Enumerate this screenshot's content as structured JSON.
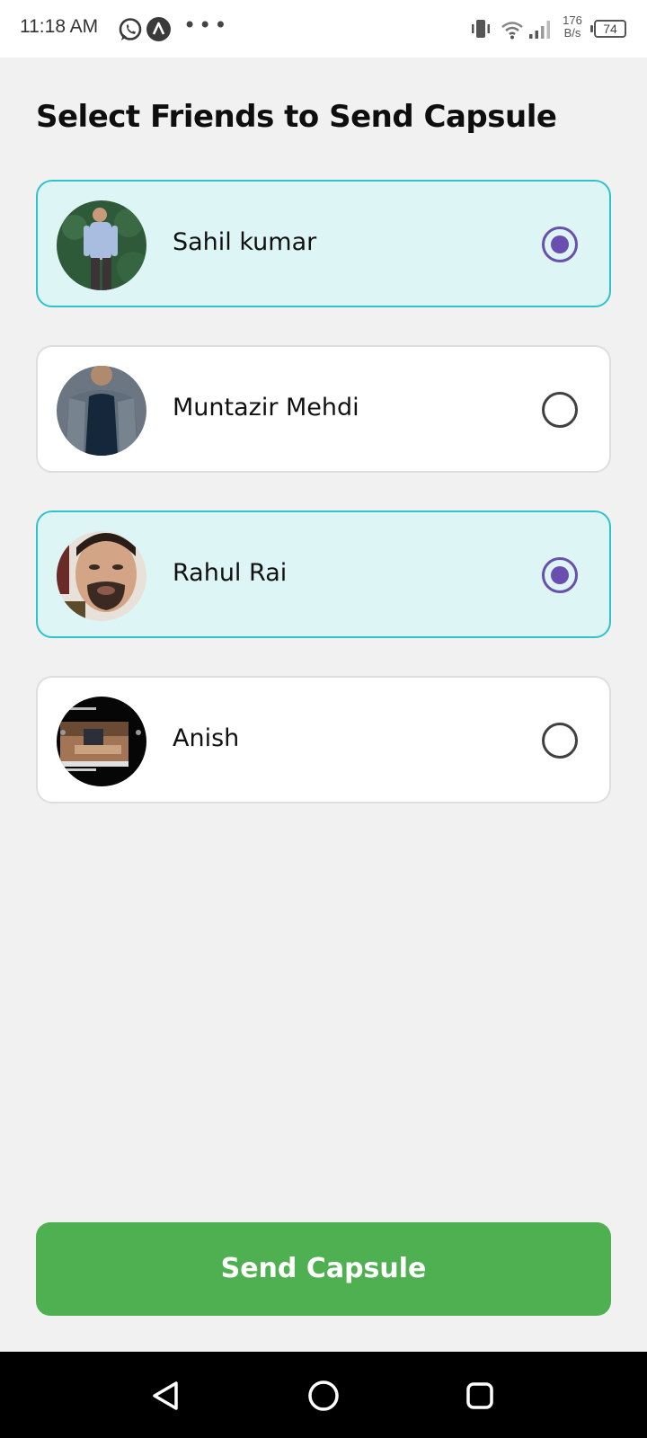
{
  "status_bar": {
    "time": "11:18 AM",
    "icons": [
      "whatsapp-icon",
      "a-icon",
      "more-dots-icon",
      "vibrate-icon",
      "wifi-icon",
      "signal-icon",
      "battery-icon"
    ],
    "dots": "•••",
    "speed_value": "176",
    "speed_unit": "B/s",
    "battery": "74"
  },
  "page": {
    "title": "Select Friends to Send Capsule"
  },
  "friends": [
    {
      "name": "Sahil kumar",
      "selected": true
    },
    {
      "name": "Muntazir Mehdi",
      "selected": false
    },
    {
      "name": "Rahul Rai",
      "selected": true
    },
    {
      "name": "Anish",
      "selected": false
    }
  ],
  "actions": {
    "send_label": "Send Capsule"
  },
  "colors": {
    "selected_bg": "#def5f6",
    "selected_border": "#2fc2cc",
    "radio_accent": "#6a4fb0",
    "send_button": "#4fb052"
  },
  "nav": {
    "icons": [
      "back-icon",
      "home-icon",
      "recents-icon"
    ]
  }
}
